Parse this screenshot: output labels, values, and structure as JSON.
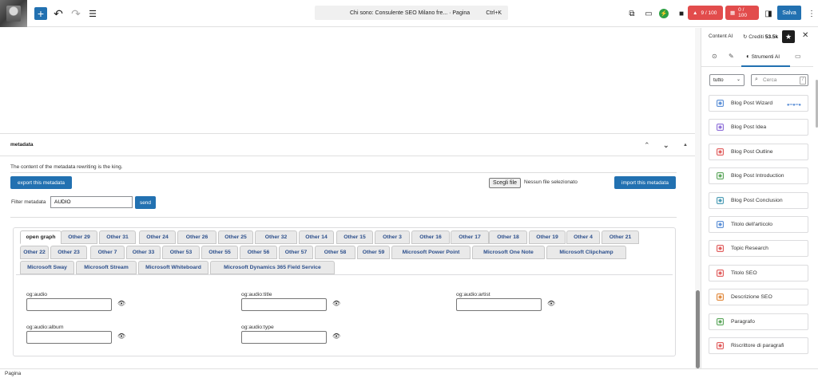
{
  "toolbar": {
    "document_title": "Chi sono: Consulente SEO Milano fre... · Pagina",
    "shortcut": "Ctrl+K",
    "badge_seo": "9 / 100",
    "badge_read": "0 / 100",
    "save_label": "Salva"
  },
  "metadata": {
    "title": "metadata",
    "description": "The content of the metadata rewriting is the king.",
    "export_label": "export this metadata",
    "choose_file_label": "Scegli file",
    "no_file_label": "Nessun file selezionato",
    "import_label": "import this metadata",
    "filter_label": "Filter metadata",
    "filter_value": "AUDIO",
    "send_label": "send"
  },
  "tabs": [
    "open graph",
    "Other 29",
    "Other 31",
    "Other 24",
    "Other 26",
    "Other 25",
    "Other 32",
    "Other 14",
    "Other 15",
    "Other 3",
    "Other 16",
    "Other 17",
    "Other 18",
    "Other 19",
    "Other 4",
    "Other 21",
    "Other 22",
    "Other 23",
    "Other 7",
    "Other 33",
    "Other 53",
    "Other 55",
    "Other 56",
    "Other 57",
    "Other 58",
    "Other 59",
    "Microsoft Power Point",
    "Microsoft One Note",
    "Microsoft Clipchamp",
    "Microsoft Sway",
    "Microsoft Stream",
    "Microsoft Whiteboard",
    "Microsoft Dynamics 365 Field Service"
  ],
  "fields": [
    "og:audio",
    "og:audio:title",
    "og:audio:artist",
    "og:audio:album",
    "og:audio:type"
  ],
  "status": {
    "label": "Pagina"
  },
  "sidebar": {
    "title": "Content AI",
    "credits_label": "Crediti",
    "credits_value": "53.5k",
    "active_tab": "Strumenti AI",
    "filter_value": "tutto",
    "search_placeholder": "Cerca",
    "search_shortcut": "/",
    "tools": [
      {
        "label": "Blog Post Wizard",
        "color": "#5b8fd6"
      },
      {
        "label": "Blog Post Idea",
        "color": "#8e6fd8"
      },
      {
        "label": "Blog Post Outline",
        "color": "#e05a5a"
      },
      {
        "label": "Blog Post Introduction",
        "color": "#5aa55a"
      },
      {
        "label": "Blog Post Conclusion",
        "color": "#4a9bb5"
      },
      {
        "label": "Titolo dell'articolo",
        "color": "#5b8fd6"
      },
      {
        "label": "Topic Research",
        "color": "#e05a5a"
      },
      {
        "label": "Titolo SEO",
        "color": "#e05a5a"
      },
      {
        "label": "Descrizione SEO",
        "color": "#e0883a"
      },
      {
        "label": "Paragrafo",
        "color": "#5aa55a"
      },
      {
        "label": "Riscrittore di paragrafi",
        "color": "#e05a5a"
      }
    ]
  }
}
